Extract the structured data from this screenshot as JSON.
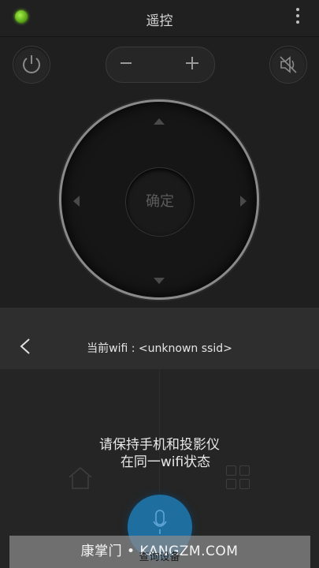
{
  "header": {
    "title": "遥控"
  },
  "remote": {
    "ok_label": "确定"
  },
  "panel": {
    "wifi_label": "当前wifi : <unknown ssid>",
    "message_line1": "请保持手机和投影仪",
    "message_line2": "在同一wifi状态",
    "search_button": "查询设备"
  },
  "watermark": "康掌门 • KANGZM.COM",
  "colors": {
    "status_dot": "#7ed32a",
    "mic_button": "#1f6ea0",
    "background": "#1e1e1e"
  }
}
